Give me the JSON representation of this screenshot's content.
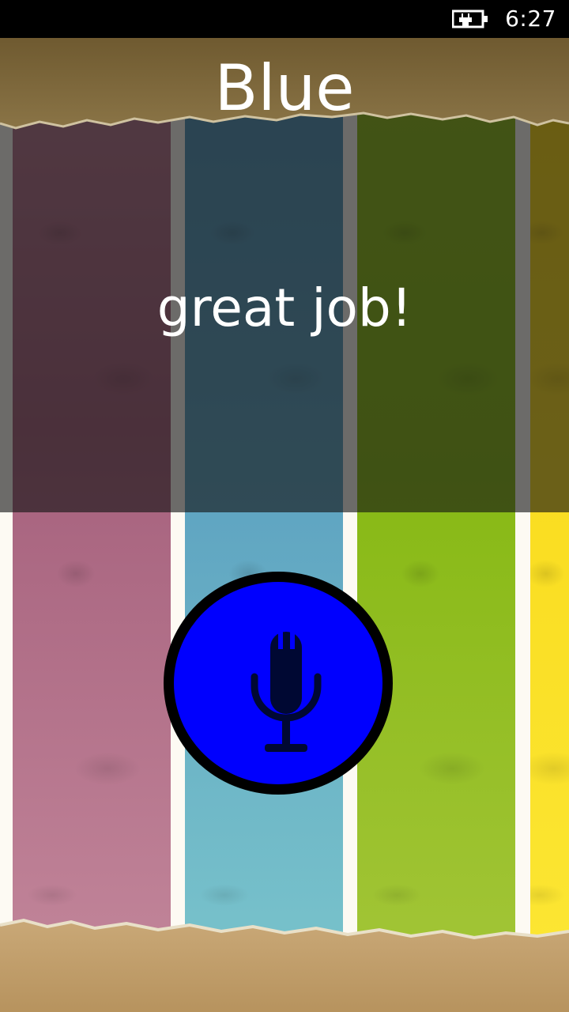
{
  "status_bar": {
    "battery_icon": "battery-charging-icon",
    "time": "6:27"
  },
  "color_word": "Blue",
  "feedback_text": "great job!",
  "mic_button": {
    "icon": "microphone-icon",
    "fill_color": "#0000fe",
    "ring_color": "#000000"
  },
  "stripe_colors": [
    "#a5607c",
    "#5ea3c1",
    "#87b915",
    "#f7d40f"
  ]
}
